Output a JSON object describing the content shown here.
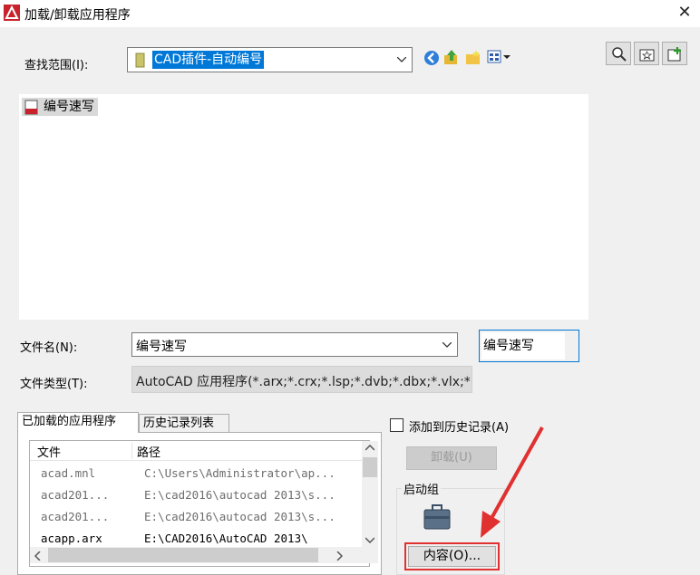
{
  "window": {
    "title": "加载/卸载应用程序",
    "close_glyph": "✕",
    "icon": "autocad-app-icon"
  },
  "lookin": {
    "label": "查找范围(I):",
    "value": "CAD插件-自动编号",
    "toolbar_icons": [
      "back-icon",
      "up-folder-icon",
      "new-folder-icon",
      "views-menu-icon"
    ],
    "right_icons": [
      "find-icon",
      "favorites-icon",
      "add-favorite-icon"
    ]
  },
  "files": [
    {
      "name": "编号速写",
      "icon": "lisp-file-icon"
    }
  ],
  "filename": {
    "label": "文件名(N):",
    "value": "编号速写",
    "load_button": "编号速写"
  },
  "filetype": {
    "label": "文件类型(T):",
    "value": "AutoCAD 应用程序(*.arx;*.crx;*.lsp;*.dvb;*.dbx;*.vlx;*.fas)"
  },
  "tabs": [
    {
      "label": "已加载的应用程序",
      "active": true
    },
    {
      "label": "历史记录列表",
      "active": false
    }
  ],
  "table": {
    "columns": [
      "文件",
      "路径"
    ],
    "rows": [
      {
        "file": "acad.mnl",
        "path": "C:\\Users\\Administrator\\ap...",
        "dim": true
      },
      {
        "file": "acad201...",
        "path": "E:\\cad2016\\autocad 2013\\s...",
        "dim": true
      },
      {
        "file": "acad201...",
        "path": "E:\\cad2016\\autocad 2013\\s...",
        "dim": true
      },
      {
        "file": "acapp.arx",
        "path": "E:\\CAD2016\\AutoCAD 2013\\",
        "dim": false
      }
    ]
  },
  "history_checkbox": {
    "label": "添加到历史记录(A)",
    "checked": false
  },
  "unload_button": "卸载(U)",
  "startup_suite": {
    "label": "启动组",
    "icon": "briefcase-icon",
    "contents_button": "内容(O)..."
  },
  "colors": {
    "selection": "#0078d7",
    "annotation_red": "#e0302f"
  }
}
